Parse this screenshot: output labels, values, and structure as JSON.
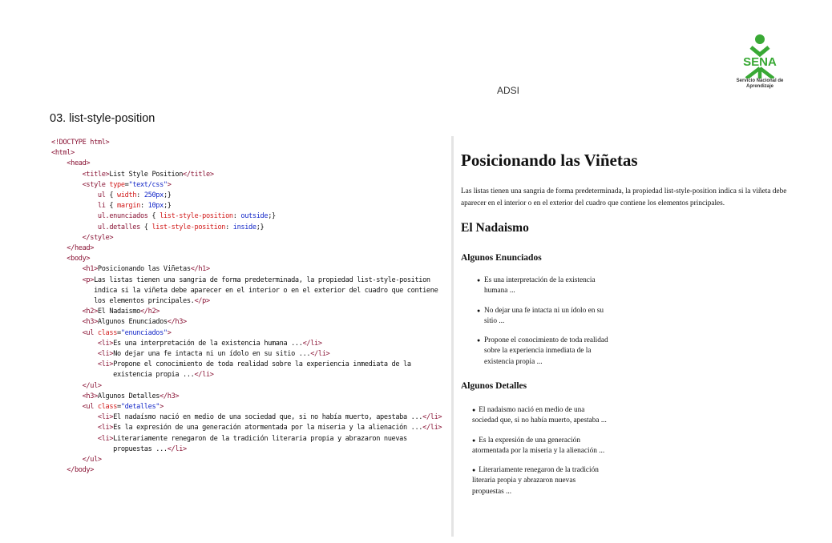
{
  "header": {
    "logo_text": "SENA",
    "logo_subtitle": "Servicio Nacional de Aprendizaje",
    "center_label": "ADSI",
    "section_title": "03. list-style-position"
  },
  "code": {
    "lines": [
      "<!DOCTYPE html>",
      "<html>",
      "    <head>",
      "        <title>List Style Position</title>",
      "        <style type=\"text/css\">",
      "            ul { width: 250px;}",
      "            li { margin: 10px;}",
      "            ul.enunciados { list-style-position: outside;}",
      "            ul.detalles { list-style-position: inside;}",
      "        </style>",
      "    </head>",
      "    <body>",
      "        <h1>Posicionando las Viñetas</h1>",
      "        <p>Las listas tienen una sangria de forma predeterminada, la propiedad list-style-position",
      "           indica si la viñeta debe aparecer en el interior o en el exterior del cuadro que contiene",
      "           los elementos principales.</p>",
      "        <h2>El Nadaismo</h2>",
      "        <h3>Algunos Enunciados</h3>",
      "        <ul class=\"enunciados\">",
      "            <li>Es una interpretación de la existencia humana ...</li>",
      "            <li>No dejar una fe intacta ni un ídolo en su sitio ...</li>",
      "            <li>Propone el conocimiento de toda realidad sobre la experiencia inmediata de la",
      "                existencia propia ...</li>",
      "        </ul>",
      "        <h3>Algunos Detalles</h3>",
      "        <ul class=\"detalles\">",
      "            <li>El nadaísmo nació en medio de una sociedad que, si no había muerto, apestaba ...</li>",
      "            <li>Es la expresión de una generación atormentada por la miseria y la alienación ...</li>",
      "            <li>Literariamente renegaron de la tradición literaria propia y abrazaron nuevas",
      "                propuestas ...</li>",
      "        </ul>",
      "    </body>"
    ]
  },
  "preview": {
    "h1": "Posicionando las Viñetas",
    "paragraph": "Las listas tienen una sangria de forma predeterminada, la propiedad list-style-position indica si la viñeta debe aparecer en el interior o en el exterior del cuadro que contiene los elementos principales.",
    "h2": "El Nadaismo",
    "h3_enunciados": "Algunos Enunciados",
    "enunciados": [
      "Es una interpretación de la existencia humana ...",
      "No dejar una fe intacta ni un ídolo en su sitio ...",
      "Propone el conocimiento de toda realidad sobre la experiencia inmediata de la existencia propia ..."
    ],
    "h3_detalles": "Algunos Detalles",
    "detalles": [
      "El nadaismo nació en medio de una sociedad que, si no había muerto, apestaba ...",
      "Es la expresión de una generación atormentada por la miseria y la alienación ...",
      "Literariamente renegaron de la tradición literaria propia y abrazaron nuevas propuestas ..."
    ],
    "bullet": "●"
  },
  "colors": {
    "logo_green": "#39a935",
    "tag": "#8a1536",
    "property": "#d11a1a",
    "value": "#1428c8"
  }
}
